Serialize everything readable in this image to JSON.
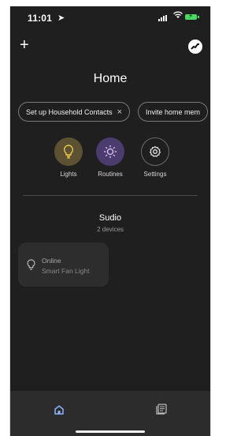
{
  "status_bar": {
    "time": "11:01"
  },
  "header": {
    "title": "Home",
    "add_label": "+"
  },
  "chips": [
    {
      "label": "Set up Household Contacts",
      "close": "×"
    },
    {
      "label": "Invite home mem"
    }
  ],
  "favorites": [
    {
      "label": "Lights",
      "icon": "lightbulb-icon",
      "color": "#5d5133",
      "icon_color": "#f2c94c"
    },
    {
      "label": "Routines",
      "icon": "routines-sun-icon",
      "color": "#4b3c6e",
      "icon_color": "#d8c8ff"
    },
    {
      "label": "Settings",
      "icon": "gear-icon",
      "color": "#1f1f1f",
      "icon_color": "#e8e8e8"
    }
  ],
  "room": {
    "name": "Sudio",
    "device_count": "2 devices"
  },
  "device": {
    "state": "Online",
    "name": "Smart Fan Light",
    "icon": "lightbulb-icon"
  },
  "bottom_nav": [
    {
      "name": "home-tab",
      "icon": "home-icon",
      "active": true
    },
    {
      "name": "feed-tab",
      "icon": "list-icon",
      "active": false
    }
  ],
  "colors": {
    "background": "#1f1f1f",
    "accent": "#8ab4f8",
    "card": "#2d2d2d"
  }
}
